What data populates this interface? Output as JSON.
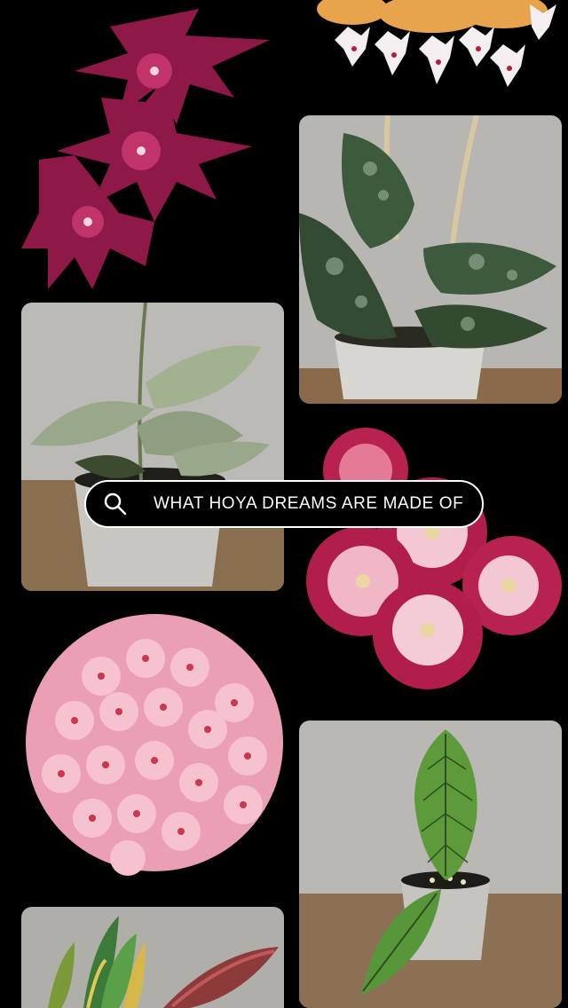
{
  "search": {
    "query": "WHAT HOYA DREAMS ARE MADE OF",
    "icon": "search-icon"
  },
  "grid": {
    "tiles": [
      {
        "id": "hoya-purple-star-flowers",
        "icon": "flower-cluster"
      },
      {
        "id": "hoya-orange-white-flowers",
        "icon": "flower-cluster"
      },
      {
        "id": "hoya-dark-splash-leaf-plant",
        "icon": "potted-plant"
      },
      {
        "id": "hoya-silver-leaf-plant",
        "icon": "potted-plant"
      },
      {
        "id": "hoya-pink-cup-flowers",
        "icon": "flower-cluster"
      },
      {
        "id": "hoya-pink-umbel-flowers",
        "icon": "flower-cluster"
      },
      {
        "id": "hoya-veined-leaf-plant",
        "icon": "potted-plant"
      },
      {
        "id": "hoya-variegated-leaves",
        "icon": "potted-plant"
      }
    ]
  },
  "colors": {
    "background": "#000000",
    "pill_border": "#ffffff",
    "text": "#ffffff"
  }
}
